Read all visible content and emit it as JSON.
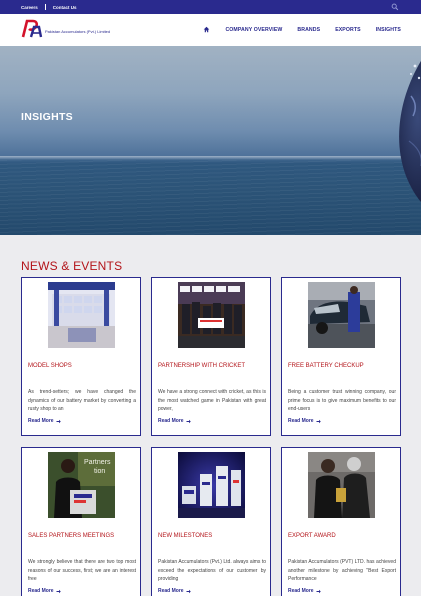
{
  "topbar": {
    "careers": "Careers",
    "contact": "Contact Us"
  },
  "brand": {
    "name": "Pakistan Accumulators (Pvt.) Limited"
  },
  "nav": [
    "COMPANY OVERVIEW",
    "BRANDS",
    "EXPORTS",
    "INSIGHTS"
  ],
  "hero": {
    "title": "INSIGHTS"
  },
  "news": {
    "title": "NEWS & EVENTS",
    "read_more": "Read More",
    "cards": [
      {
        "title": "MODEL SHOPS",
        "desc": "As trend-setters; we have changed the dynamics of our battery market by converting a rusty shop to an",
        "image": "battery-shop-photo"
      },
      {
        "title": "PARTNERSHIP WITH CRICKET",
        "desc": "We have a strong connect with cricket, as this is the most watched game in Pakistan with great power,",
        "image": "cricket-partnership-photo"
      },
      {
        "title": "FREE BATTERY CHECKUP",
        "desc": "Being a customer trust winning company, our prime focus is to give maximum benefits to our end-users",
        "image": "battery-checkup-photo"
      },
      {
        "title": "SALES PARTNERS MEETINGS",
        "desc": "We strongly believe that there are two top most reasons of our success, first; we are an interest free",
        "image": "sales-meeting-photo",
        "photo_text": "Partners\ntion"
      },
      {
        "title": "NEW MILESTONES",
        "desc": "Pakistan Accumulators (Pvt.) Ltd. always aims to exceed the expectations of our customer by providing",
        "image": "battery-products-photo"
      },
      {
        "title": "EXPORT AWARD",
        "desc": "Pakistan Accumulators (PVT) LTD. has achieved another milestone by achieving \"Best Export Performance",
        "image": "export-award-photo"
      }
    ]
  },
  "colors": {
    "navy": "#2a2a8e",
    "red": "#b3141a"
  },
  "icons": {
    "search": "search-icon",
    "home": "home-icon",
    "arrow": "arrow-right-icon"
  }
}
